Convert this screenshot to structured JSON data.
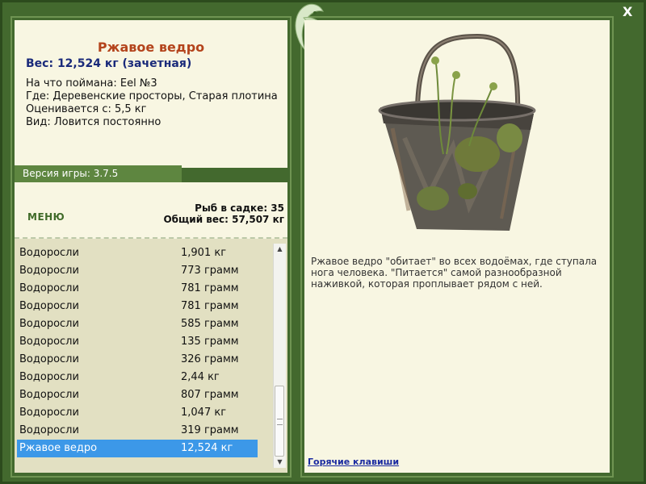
{
  "fish": {
    "title": "Ржавое ведро",
    "weight": "Вес: 12,524 кг (зачетная)",
    "caught_on": "На что поймана: Eel №3",
    "location": "Где: Деревенские просторы, Старая плотина",
    "valued_from": "Оценивается с: 5,5 кг",
    "type": "Вид: Ловится постоянно"
  },
  "version": "Версия игры: 3.7.5",
  "menu_label": "МЕНЮ",
  "catch_count": "Рыб в садке: 35",
  "total_weight": "Общий вес: 57,507 кг",
  "list": [
    {
      "name": "Водоросли",
      "weight": "1,901 кг"
    },
    {
      "name": "Водоросли",
      "weight": "773 грамм"
    },
    {
      "name": "Водоросли",
      "weight": "781 грамм"
    },
    {
      "name": "Водоросли",
      "weight": "781 грамм"
    },
    {
      "name": "Водоросли",
      "weight": "585 грамм"
    },
    {
      "name": "Водоросли",
      "weight": "135 грамм"
    },
    {
      "name": "Водоросли",
      "weight": "326 грамм"
    },
    {
      "name": "Водоросли",
      "weight": "2,44 кг"
    },
    {
      "name": "Водоросли",
      "weight": "807 грамм"
    },
    {
      "name": "Водоросли",
      "weight": "1,047 кг"
    },
    {
      "name": "Водоросли",
      "weight": "319 грамм"
    },
    {
      "name": "Ржавое ведро",
      "weight": "12,524 кг",
      "selected": true
    }
  ],
  "description": "Ржавое ведро \"обитает\" во всех водоёмах, где ступала нога человека. \"Питается\" самой разнообразной наживкой, которая проплывает рядом с ней.",
  "hotkeys": "Горячие клавиши",
  "close_symbol": "X"
}
